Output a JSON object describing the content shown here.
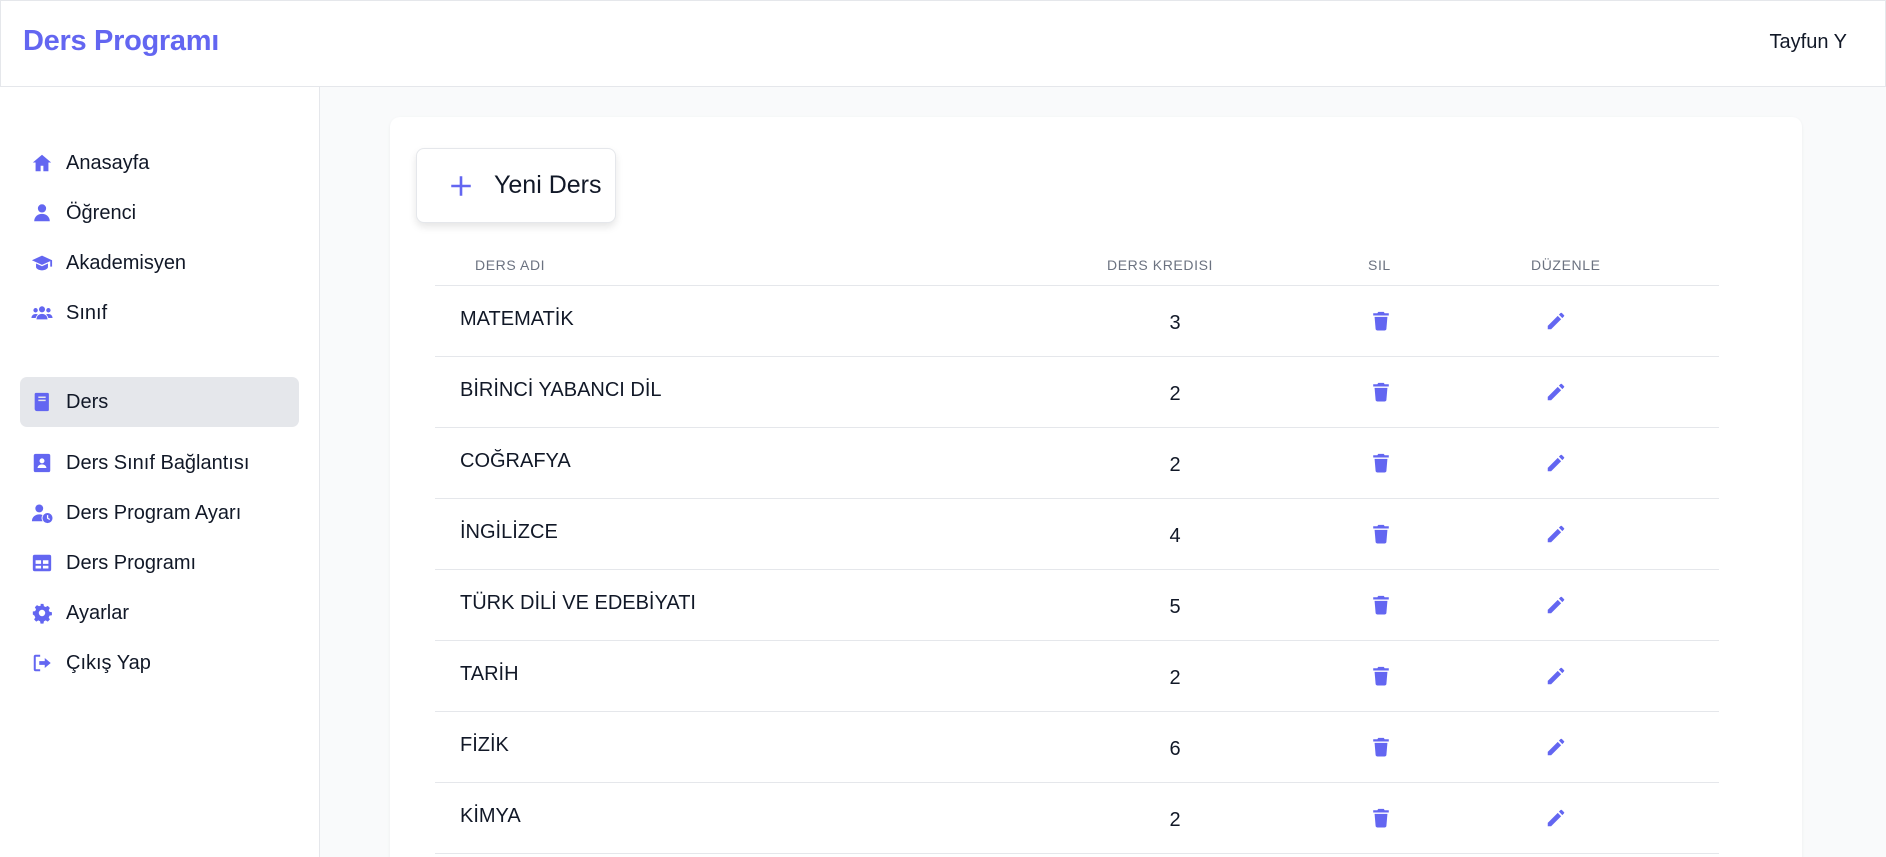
{
  "header": {
    "title": "Ders Programı",
    "user": "Tayfun Y"
  },
  "sidebar": {
    "items": [
      {
        "label": "Anasayfa",
        "icon": "home-icon"
      },
      {
        "label": "Öğrenci",
        "icon": "user-icon"
      },
      {
        "label": "Akademisyen",
        "icon": "graduation-cap-icon"
      },
      {
        "label": "Sınıf",
        "icon": "users-icon"
      },
      {
        "label": "Ders",
        "icon": "book-icon",
        "active": true
      },
      {
        "label": "Ders Sınıf Bağlantısı",
        "icon": "contact-book-icon"
      },
      {
        "label": "Ders Program Ayarı",
        "icon": "user-clock-icon"
      },
      {
        "label": "Ders Programı",
        "icon": "table-icon"
      },
      {
        "label": "Ayarlar",
        "icon": "gear-icon"
      },
      {
        "label": "Çıkış Yap",
        "icon": "sign-out-icon"
      }
    ]
  },
  "main": {
    "new_button_label": "Yeni Ders",
    "columns": {
      "name": "DERS ADI",
      "credit": "DERS KREDISI",
      "delete": "SIL",
      "edit": "DÜZENLE"
    },
    "rows": [
      {
        "name": "MATEMATİK",
        "credit": "3"
      },
      {
        "name": "BİRİNCİ YABANCI DİL",
        "credit": "2"
      },
      {
        "name": "COĞRAFYA",
        "credit": "2"
      },
      {
        "name": "İNGİLİZCE",
        "credit": "4"
      },
      {
        "name": "TÜRK DİLİ VE EDEBİYATI",
        "credit": "5"
      },
      {
        "name": "TARİH",
        "credit": "2"
      },
      {
        "name": "FİZİK",
        "credit": "6"
      },
      {
        "name": "KİMYA",
        "credit": "2"
      }
    ]
  },
  "colors": {
    "accent": "#6366f1",
    "active_bg": "#e5e7eb",
    "page_bg": "#f9fafb"
  }
}
